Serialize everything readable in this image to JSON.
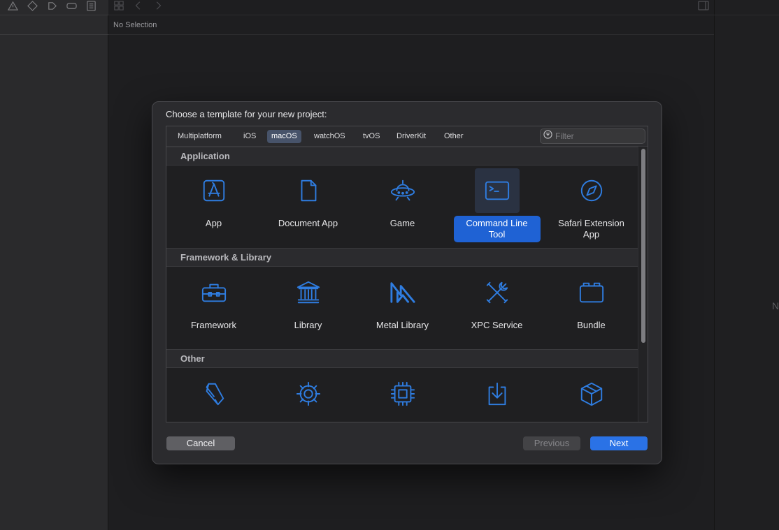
{
  "editor": {
    "path_label": "No Selection",
    "right_edge_text": "N"
  },
  "dialog": {
    "title": "Choose a template for your new project:",
    "tabs": [
      {
        "label": "Multiplatform"
      },
      {
        "label": "iOS"
      },
      {
        "label": "macOS",
        "selected": true
      },
      {
        "label": "watchOS"
      },
      {
        "label": "tvOS"
      },
      {
        "label": "DriverKit"
      },
      {
        "label": "Other"
      }
    ],
    "filter": {
      "placeholder": "Filter",
      "value": ""
    },
    "sections": [
      {
        "title": "Application",
        "templates": [
          {
            "label": "App",
            "icon": "app-store-icon"
          },
          {
            "label": "Document App",
            "icon": "document-icon"
          },
          {
            "label": "Game",
            "icon": "game-ufo-icon"
          },
          {
            "label": "Command Line Tool",
            "icon": "terminal-icon",
            "selected": true
          },
          {
            "label": "Safari Extension App",
            "icon": "compass-icon"
          }
        ]
      },
      {
        "title": "Framework & Library",
        "templates": [
          {
            "label": "Framework",
            "icon": "toolbox-icon"
          },
          {
            "label": "Library",
            "icon": "building-columns-icon"
          },
          {
            "label": "Metal Library",
            "icon": "metal-icon"
          },
          {
            "label": "XPC Service",
            "icon": "tools-icon"
          },
          {
            "label": "Bundle",
            "icon": "bundle-icon"
          }
        ]
      },
      {
        "title": "Other",
        "templates": [
          {
            "label": "",
            "icon": "scroll-icon"
          },
          {
            "label": "",
            "icon": "gear-icon"
          },
          {
            "label": "",
            "icon": "cpu-icon"
          },
          {
            "label": "",
            "icon": "download-tray-icon"
          },
          {
            "label": "",
            "icon": "shipping-box-icon"
          }
        ]
      }
    ],
    "buttons": {
      "cancel": "Cancel",
      "previous": "Previous",
      "next": "Next"
    },
    "colors": {
      "accent": "#2f7de1",
      "selection": "#1f62d4",
      "next_button": "#2a72e6"
    }
  }
}
